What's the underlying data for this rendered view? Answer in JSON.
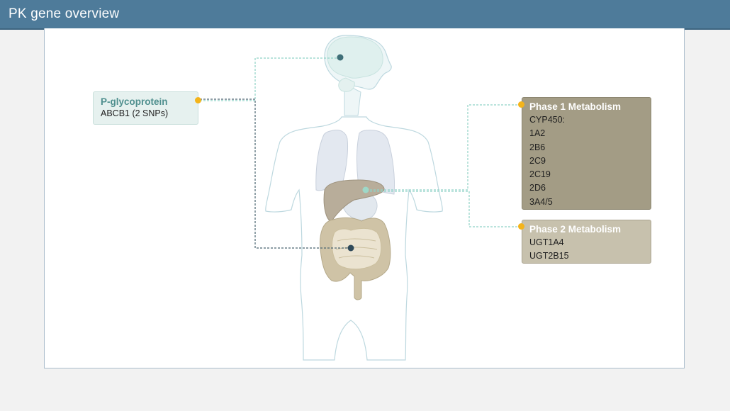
{
  "header": {
    "title": "PK gene overview"
  },
  "pgp": {
    "title": "P-glycoprotein",
    "subtitle": "ABCB1 (2 SNPs)"
  },
  "phase1": {
    "title": "Phase 1 Metabolism",
    "items": [
      "CYP450:",
      "1A2",
      "2B6",
      "2C9",
      "2C19",
      "2D6",
      "3A4/5"
    ]
  },
  "phase2": {
    "title": "Phase 2 Metabolism",
    "items": [
      "UGT1A4",
      "UGT2B15"
    ]
  },
  "colors": {
    "header": "#4e7b9a",
    "accent_dot": "#f4b41a",
    "pgp_box": "#e6f1ef",
    "phase1_box": "#a39c85",
    "phase2_box": "#c7c1ad",
    "brain_marker": "#3f6f78",
    "liver_marker": "#9ed8c8",
    "gut_marker": "#2f4a5a"
  }
}
